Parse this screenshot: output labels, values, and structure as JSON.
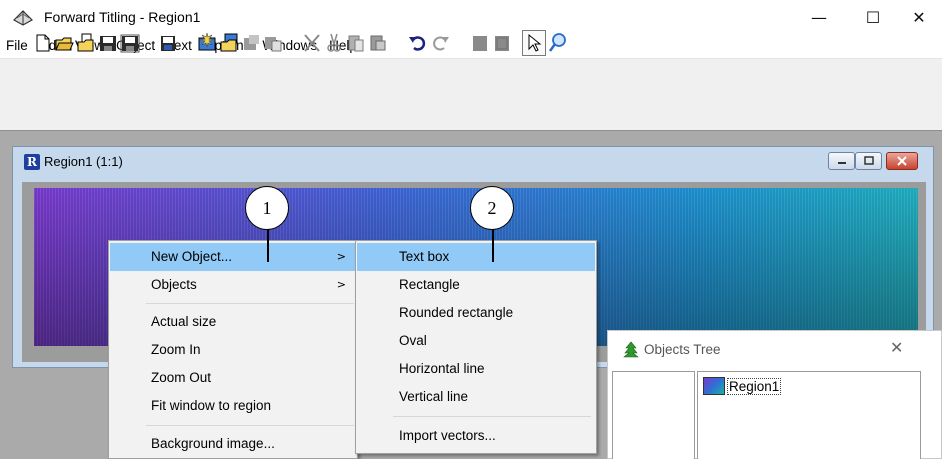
{
  "window": {
    "title": "Forward Titling - Region1",
    "controls": {
      "minimize": "—",
      "maximize": "☐",
      "close": "✕"
    }
  },
  "menubar": [
    "File",
    "Edit",
    "View",
    "Object",
    "Text",
    "Options",
    "Windows",
    "Help"
  ],
  "toolbar": {
    "buttons": [
      "new-icon",
      "open-icon",
      "open-template-icon",
      "save-icon",
      "save-all-icon",
      "save-blue-icon",
      "new-project-icon",
      "open-project-icon",
      "export-icon",
      "export-image-icon",
      "cut-icon",
      "copy-icon",
      "paste-icon",
      "paste-special-icon",
      "undo-icon",
      "redo-icon",
      "bring-front-icon",
      "send-back-icon",
      "pointer-icon",
      "zoom-icon"
    ],
    "selected": "pointer-icon"
  },
  "child_window": {
    "title": "Region1  (1:1)",
    "icon_letter": "R"
  },
  "context_menu": {
    "items": [
      {
        "label": "New Object...",
        "has_submenu": true,
        "highlighted": true
      },
      {
        "label": "Objects",
        "has_submenu": true
      },
      {
        "separator": true
      },
      {
        "label": "Actual size"
      },
      {
        "label": "Zoom In"
      },
      {
        "label": "Zoom Out"
      },
      {
        "label": "Fit window to region"
      },
      {
        "separator": true
      },
      {
        "label": "Background image..."
      }
    ],
    "submenu_arrow": ">"
  },
  "submenu": {
    "items": [
      {
        "label": "Text box",
        "highlighted": true
      },
      {
        "label": "Rectangle"
      },
      {
        "label": "Rounded rectangle"
      },
      {
        "label": "Oval"
      },
      {
        "label": "Horizontal line"
      },
      {
        "label": "Vertical line"
      },
      {
        "separator": true
      },
      {
        "label": "Import vectors..."
      }
    ]
  },
  "objects_tree": {
    "title": "Objects Tree",
    "close": "✕",
    "nodes": [
      "Region1"
    ]
  },
  "callouts": [
    "1",
    "2"
  ],
  "colors": {
    "highlight": "#91c9f7",
    "mdi_background": "#aaaaaa",
    "region_gradient_start": "#7436c7",
    "region_gradient_end": "#1ca8b9"
  }
}
